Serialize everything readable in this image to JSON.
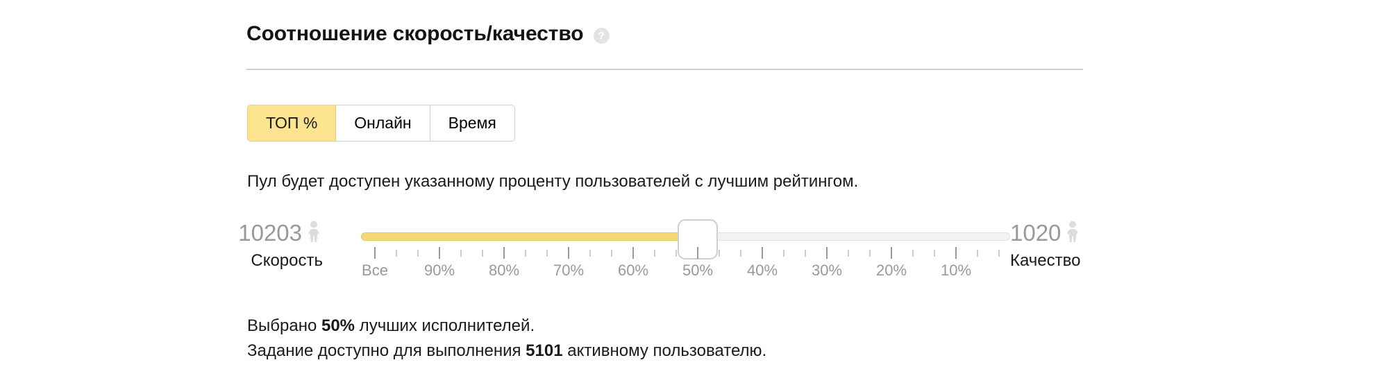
{
  "header": {
    "title": "Соотношение скорость/качество",
    "help_icon": "question-mark-icon",
    "help_label": "?"
  },
  "tabs": {
    "selected": "ТОП %",
    "items": [
      {
        "label": "ТОП %",
        "selected": true
      },
      {
        "label": "Онлайн",
        "selected": false
      },
      {
        "label": "Время",
        "selected": false
      }
    ]
  },
  "description": "Пул будет доступен указанному проценту пользователей с лучшим рейтингом.",
  "slider": {
    "left": {
      "value": "10203",
      "label": "Скорость",
      "icon": "person-icon"
    },
    "right": {
      "value": "1020",
      "label": "Качество",
      "icon": "person-icon"
    },
    "current_percent": 50,
    "fill_color": "#f5d976",
    "track_color": "#f2f2f2",
    "tick_labels": [
      "Все",
      "90%",
      "80%",
      "70%",
      "60%",
      "50%",
      "40%",
      "30%",
      "20%",
      "10%"
    ],
    "minor_ticks_between": 2
  },
  "summary": {
    "line1_prefix": "Выбрано ",
    "line1_value": "50%",
    "line1_suffix": " лучших исполнителей.",
    "line2_prefix": "Задание доступно для выполнения ",
    "line2_value": "5101",
    "line2_suffix": " активному пользователю."
  }
}
